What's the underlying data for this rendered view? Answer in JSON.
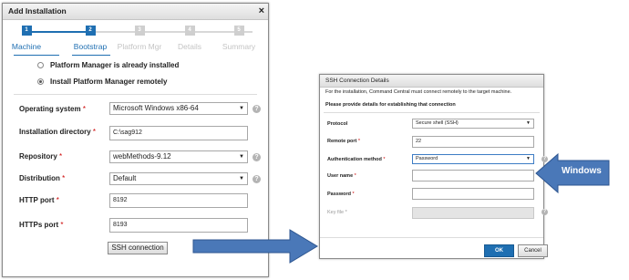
{
  "add_installation": {
    "title": "Add Installation",
    "close": "×",
    "steps": [
      {
        "number": "1",
        "label": "Machine",
        "state": "active"
      },
      {
        "number": "2",
        "label": "Bootstrap",
        "state": "active"
      },
      {
        "number": "3",
        "label": "Platform Mgr",
        "state": "inactive"
      },
      {
        "number": "4",
        "label": "Details",
        "state": "inactive"
      },
      {
        "number": "5",
        "label": "Summary",
        "state": "inactive"
      }
    ],
    "options": {
      "already_installed": "Platform Manager is already installed",
      "install_remotely": "Install Platform Manager remotely",
      "selected": "install_remotely"
    },
    "fields": {
      "os": {
        "label": "Operating system",
        "value": "Microsoft Windows x86-64"
      },
      "install_dir": {
        "label": "Installation directory",
        "value": "C:\\sag912"
      },
      "repository": {
        "label": "Repository",
        "value": "webMethods-9.12"
      },
      "distribution": {
        "label": "Distribution",
        "value": "Default"
      },
      "http_port": {
        "label": "HTTP port",
        "value": "8192"
      },
      "https_port": {
        "label": "HTTPs port",
        "value": "8193"
      }
    },
    "required_marker": "*",
    "help_glyph": "?",
    "ssh_button": "SSH connection"
  },
  "ssh_dialog": {
    "title": "SSH Connection Details",
    "intro": "For the installation, Command Central must connect remotely to the target machine.",
    "instruction": "Please provide details for establishing that connection",
    "fields": {
      "protocol": {
        "label": "Protocol",
        "value": "Secure shell (SSH)"
      },
      "remote_port": {
        "label": "Remote port",
        "value": "22"
      },
      "auth_method": {
        "label": "Authentication method",
        "value": "Password"
      },
      "user_name": {
        "label": "User name",
        "value": ""
      },
      "password": {
        "label": "Password",
        "value": ""
      },
      "key_file": {
        "label": "Key file",
        "value": ""
      }
    },
    "ok": "OK",
    "cancel": "Cancel"
  },
  "annotation": {
    "callout": "Windows",
    "colors": {
      "arrow_fill": "#4a78b8",
      "arrow_stroke": "#2e5690",
      "accent": "#1f6fb2"
    }
  }
}
